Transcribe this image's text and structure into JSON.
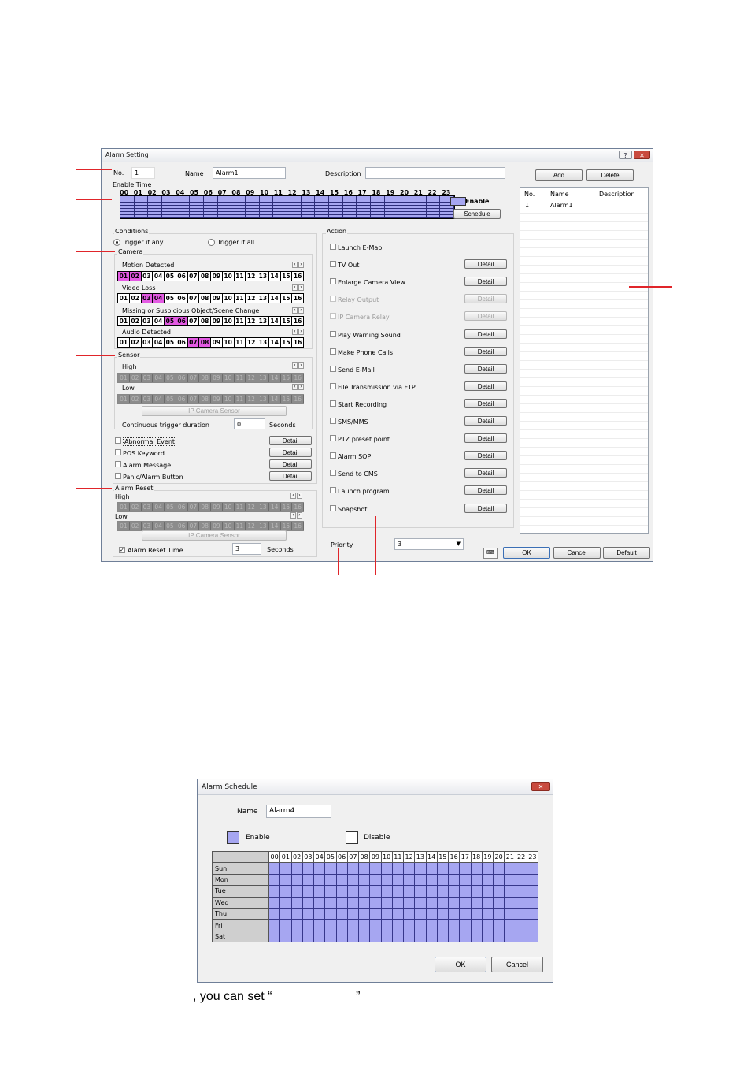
{
  "alarm_setting": {
    "title": "Alarm Setting",
    "help_glyph": "?",
    "close_glyph": "✕",
    "no_label": "No.",
    "no_value": "1",
    "name_label": "Name",
    "name_value": "Alarm1",
    "description_label": "Description",
    "description_value": "",
    "enable_time_label": "Enable Time",
    "hours": [
      "00",
      "01",
      "02",
      "03",
      "04",
      "05",
      "06",
      "07",
      "08",
      "09",
      "10",
      "11",
      "12",
      "13",
      "14",
      "15",
      "16",
      "17",
      "18",
      "19",
      "20",
      "21",
      "22",
      "23"
    ],
    "enable_legend": "Enable",
    "schedule_button": "Schedule",
    "add_button": "Add",
    "delete_button": "Delete",
    "alarm_list": {
      "columns": [
        "No.",
        "Name",
        "Description"
      ],
      "rows": [
        {
          "no": "1",
          "name": "Alarm1",
          "description": ""
        }
      ]
    },
    "conditions": {
      "label": "Conditions",
      "trigger_any": "Trigger if any",
      "trigger_all": "Trigger if all",
      "camera_label": "Camera",
      "camera_numbers": [
        "01",
        "02",
        "03",
        "04",
        "05",
        "06",
        "07",
        "08",
        "09",
        "10",
        "11",
        "12",
        "13",
        "14",
        "15",
        "16"
      ],
      "motion_detected": "Motion Detected",
      "video_loss": "Video Loss",
      "missing_object": "Missing or Suspicious Object/Scene Change",
      "audio_detected": "Audio Detected",
      "sensor_label": "Sensor",
      "high_label": "High",
      "low_label": "Low",
      "ip_camera_sensor": "IP Camera Sensor",
      "continuous_label": "Continuous trigger duration",
      "continuous_value": "0",
      "seconds_label": "Seconds",
      "abnormal_event": "Abnormal Event",
      "pos_keyword": "POS Keyword",
      "alarm_message": "Alarm Message",
      "panic_button": "Panic/Alarm Button",
      "detail": "Detail"
    },
    "alarm_reset": {
      "label": "Alarm Reset",
      "high_label": "High",
      "low_label": "Low",
      "ip_camera_sensor": "IP Camera Sensor",
      "reset_time_label": "Alarm Reset Time",
      "reset_time_value": "3",
      "seconds_label": "Seconds"
    },
    "action": {
      "label": "Action",
      "items": [
        {
          "label": "Launch E-Map",
          "detail": "",
          "disabled": false
        },
        {
          "label": "TV Out",
          "detail": "Detail",
          "disabled": false
        },
        {
          "label": "Enlarge Camera View",
          "detail": "Detail",
          "disabled": false
        },
        {
          "label": "Relay Output",
          "detail": "Detail",
          "disabled": true
        },
        {
          "label": "IP Camera Relay",
          "detail": "Detail",
          "disabled": true
        },
        {
          "label": "Play Warning Sound",
          "detail": "Detail",
          "disabled": false
        },
        {
          "label": "Make Phone Calls",
          "detail": "Detail",
          "disabled": false
        },
        {
          "label": "Send E-Mail",
          "detail": "Detail",
          "disabled": false
        },
        {
          "label": "File Transmission via FTP",
          "detail": "Detail",
          "disabled": false
        },
        {
          "label": "Start Recording",
          "detail": "Detail",
          "disabled": false
        },
        {
          "label": "SMS/MMS",
          "detail": "Detail",
          "disabled": false
        },
        {
          "label": "PTZ preset point",
          "detail": "Detail",
          "disabled": false
        },
        {
          "label": "Alarm SOP",
          "detail": "Detail",
          "disabled": false
        },
        {
          "label": "Send to CMS",
          "detail": "Detail",
          "disabled": false
        },
        {
          "label": "Launch program",
          "detail": "Detail",
          "disabled": false
        },
        {
          "label": "Snapshot",
          "detail": "Detail",
          "disabled": false
        }
      ]
    },
    "priority_label": "Priority",
    "priority_value": "3",
    "ok_button": "OK",
    "cancel_button": "Cancel",
    "default_button": "Default"
  },
  "alarm_schedule": {
    "title": "Alarm Schedule",
    "close_glyph": "✕",
    "name_label": "Name",
    "name_value": "Alarm4",
    "enable_label": "Enable",
    "disable_label": "Disable",
    "hours": [
      "00",
      "01",
      "02",
      "03",
      "04",
      "05",
      "06",
      "07",
      "08",
      "09",
      "10",
      "11",
      "12",
      "13",
      "14",
      "15",
      "16",
      "17",
      "18",
      "19",
      "20",
      "21",
      "22",
      "23"
    ],
    "days": [
      "Sun",
      "Mon",
      "Tue",
      "Wed",
      "Thu",
      "Fri",
      "Sat"
    ],
    "ok_button": "OK",
    "cancel_button": "Cancel"
  },
  "caption": ", you can set “                        ”",
  "colors": {
    "enabled_cell": "#a6a6f1",
    "selected_camera": "#e35ae3",
    "callout": "#e0252a"
  }
}
